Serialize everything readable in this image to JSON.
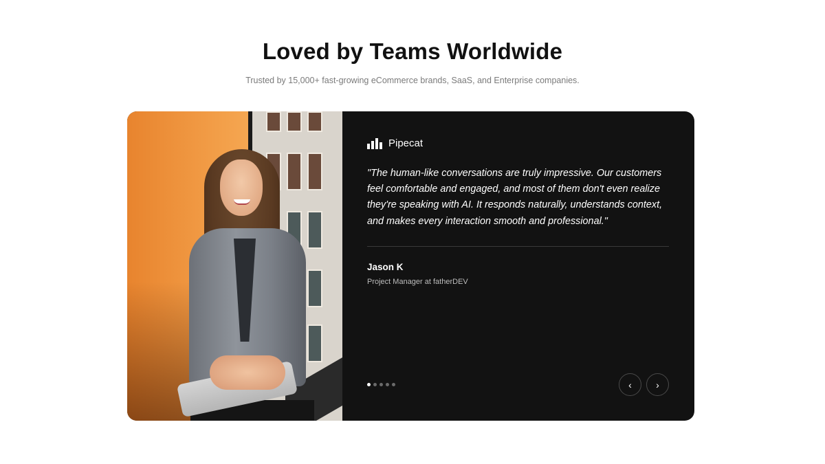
{
  "header": {
    "title": "Loved by Teams Worldwide",
    "subtitle": "Trusted by 15,000+ fast-growing eCommerce brands, SaaS, and Enterprise companies."
  },
  "testimonial": {
    "brand_icon": "bar-chart-icon",
    "brand_name": "Pipecat",
    "quote": "\"The human-like conversations are truly impressive. Our customers feel comfortable and engaged, and most of them don't even realize they're speaking with AI. It responds naturally, understands context, and makes every interaction smooth and professional.\"",
    "author_name": "Jason K",
    "author_role": "Project Manager at fatherDEV"
  },
  "carousel": {
    "slide_count": 5,
    "active_index": 0,
    "prev_icon": "chevron-left-icon",
    "next_icon": "chevron-right-icon",
    "prev_glyph": "‹",
    "next_glyph": "›"
  },
  "colors": {
    "card_background": "#121212",
    "accent_text": "#ffffff",
    "muted_text": "#7a7a7a"
  }
}
